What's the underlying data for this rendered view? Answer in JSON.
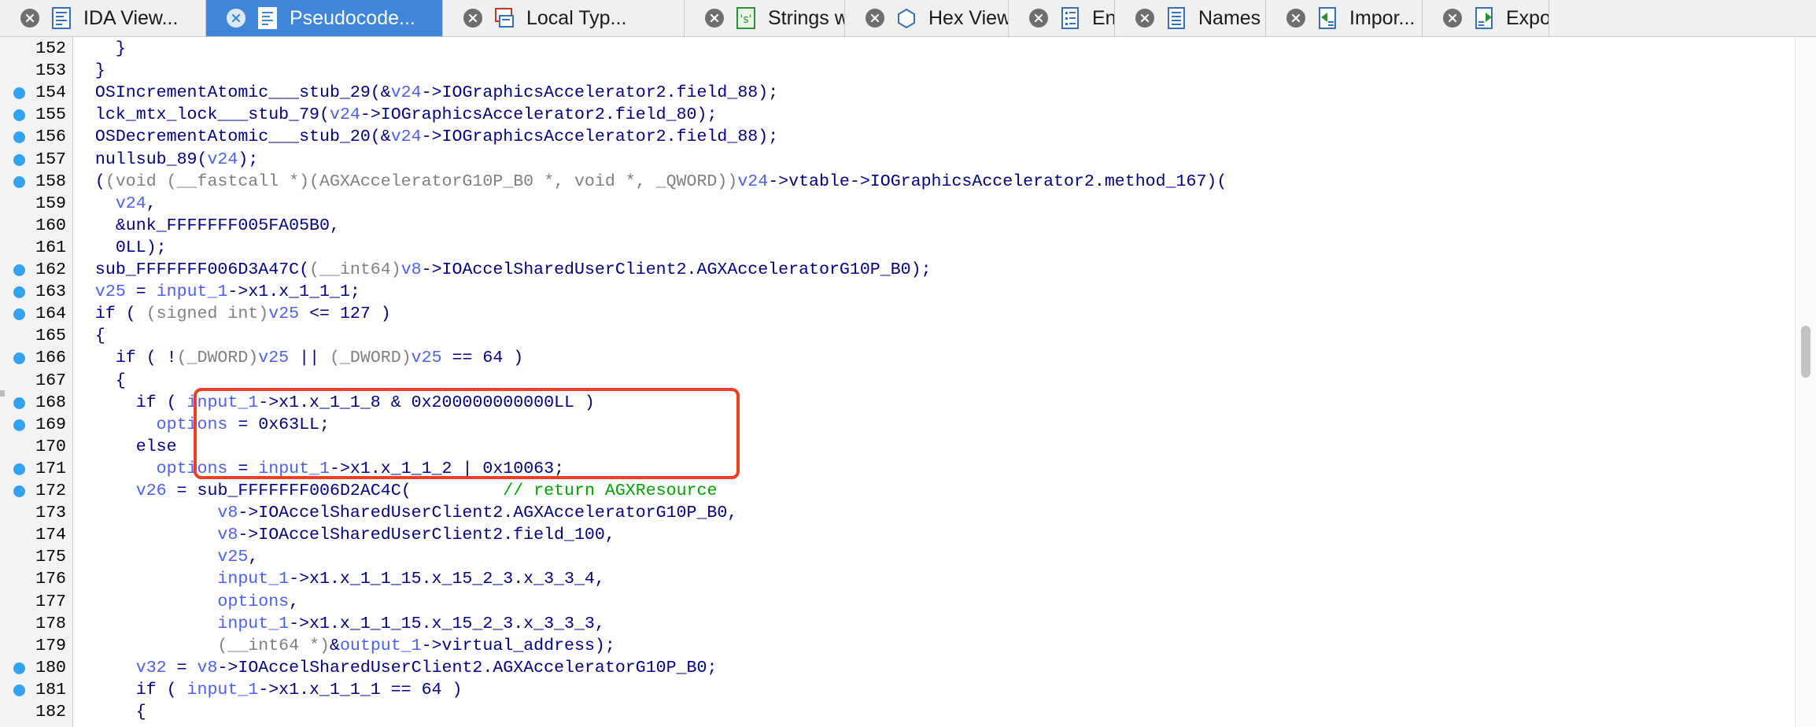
{
  "tabs": [
    {
      "label": "IDA View...",
      "icon": "ida-view-icon",
      "active": false
    },
    {
      "label": "Pseudocode...",
      "icon": "pseudocode-icon",
      "active": true
    },
    {
      "label": "Local Typ...",
      "icon": "local-types-icon",
      "active": false
    },
    {
      "label": "Strings wind...",
      "icon": "strings-icon",
      "active": false
    },
    {
      "label": "Hex View...",
      "icon": "hex-view-icon",
      "active": false
    },
    {
      "label": "Enu...",
      "icon": "enums-icon",
      "active": false
    },
    {
      "label": "Names wind...",
      "icon": "names-icon",
      "active": false
    },
    {
      "label": "Impor...",
      "icon": "imports-icon",
      "active": false
    },
    {
      "label": "Expor...",
      "icon": "exports-icon",
      "active": false
    }
  ],
  "code_lines": [
    {
      "num": "152",
      "bp": false,
      "text": "    }"
    },
    {
      "num": "153",
      "bp": false,
      "text": "  }"
    },
    {
      "num": "154",
      "bp": true,
      "text": "  OSIncrementAtomic___stub_29(&v24->IOGraphicsAccelerator2.field_88);"
    },
    {
      "num": "155",
      "bp": true,
      "text": "  lck_mtx_lock___stub_79(v24->IOGraphicsAccelerator2.field_80);"
    },
    {
      "num": "156",
      "bp": true,
      "text": "  OSDecrementAtomic___stub_20(&v24->IOGraphicsAccelerator2.field_88);"
    },
    {
      "num": "157",
      "bp": true,
      "text": "  nullsub_89(v24);"
    },
    {
      "num": "158",
      "bp": true,
      "text": "  ((void (__fastcall *)(AGXAcceleratorG10P_B0 *, void *, _QWORD))v24->vtable->IOGraphicsAccelerator2.method_167)("
    },
    {
      "num": "159",
      "bp": false,
      "text": "    v24,"
    },
    {
      "num": "160",
      "bp": false,
      "text": "    &unk_FFFFFFF005FA05B0,"
    },
    {
      "num": "161",
      "bp": false,
      "text": "    0LL);"
    },
    {
      "num": "162",
      "bp": true,
      "text": "  sub_FFFFFFF006D3A47C((__int64)v8->IOAccelSharedUserClient2.AGXAcceleratorG10P_B0);"
    },
    {
      "num": "163",
      "bp": true,
      "text": "  v25 = input_1->x1.x_1_1_1;"
    },
    {
      "num": "164",
      "bp": true,
      "text": "  if ( (signed int)v25 <= 127 )"
    },
    {
      "num": "165",
      "bp": false,
      "text": "  {"
    },
    {
      "num": "166",
      "bp": true,
      "text": "    if ( !(_DWORD)v25 || (_DWORD)v25 == 64 )"
    },
    {
      "num": "167",
      "bp": false,
      "text": "    {"
    },
    {
      "num": "168",
      "bp": true,
      "text": "      if ( input_1->x1.x_1_1_8 & 0x200000000000LL )"
    },
    {
      "num": "169",
      "bp": true,
      "text": "        options = 0x63LL;"
    },
    {
      "num": "170",
      "bp": false,
      "text": "      else"
    },
    {
      "num": "171",
      "bp": true,
      "text": "        options = input_1->x1.x_1_1_2 | 0x10063;"
    },
    {
      "num": "172",
      "bp": true,
      "text": "      v26 = sub_FFFFFFF006D2AC4C(         // return AGXResource"
    },
    {
      "num": "173",
      "bp": false,
      "text": "              v8->IOAccelSharedUserClient2.AGXAcceleratorG10P_B0,"
    },
    {
      "num": "174",
      "bp": false,
      "text": "              v8->IOAccelSharedUserClient2.field_100,"
    },
    {
      "num": "175",
      "bp": false,
      "text": "              v25,"
    },
    {
      "num": "176",
      "bp": false,
      "text": "              input_1->x1.x_1_1_15.x_15_2_3.x_3_3_4,"
    },
    {
      "num": "177",
      "bp": false,
      "text": "              options,"
    },
    {
      "num": "178",
      "bp": false,
      "text": "              input_1->x1.x_1_1_15.x_15_2_3.x_3_3_3,"
    },
    {
      "num": "179",
      "bp": false,
      "text": "              (__int64 *)&output_1->virtual_address);"
    },
    {
      "num": "180",
      "bp": true,
      "text": "      v32 = v8->IOAccelSharedUserClient2.AGXAcceleratorG10P_B0;"
    },
    {
      "num": "181",
      "bp": true,
      "text": "      if ( input_1->x1.x_1_1_1 == 64 )"
    },
    {
      "num": "182",
      "bp": false,
      "text": "      {"
    }
  ],
  "colors": {
    "active_tab": "#3d86d9",
    "breakpoint_dot": "#32a3f0",
    "highlight_box": "#ea3e25",
    "code_text": "#000080",
    "variable": "#4d5ff2",
    "comment": "#00a000"
  }
}
